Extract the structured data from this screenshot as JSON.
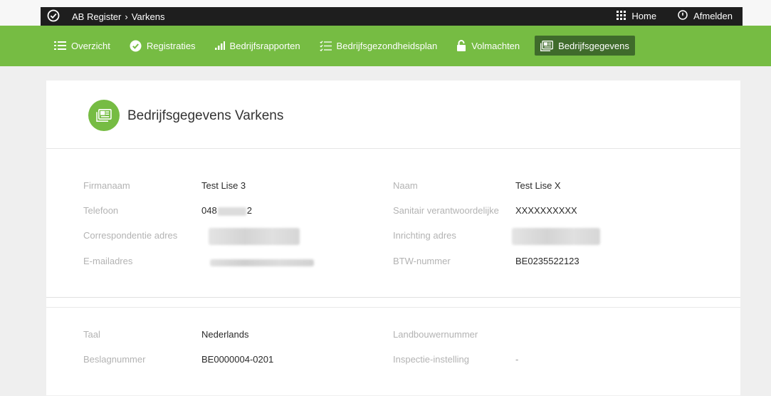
{
  "topbar": {
    "app": "AB Register",
    "separator": "›",
    "section": "Varkens",
    "home": "Home",
    "logout": "Afmelden"
  },
  "nav": [
    {
      "label": "Overzicht",
      "icon": "list-icon"
    },
    {
      "label": "Registraties",
      "icon": "check-circle-icon"
    },
    {
      "label": "Bedrijfsrapporten",
      "icon": "bar-chart-icon"
    },
    {
      "label": "Bedrijfsgezondheidsplan",
      "icon": "checklist-icon"
    },
    {
      "label": "Volmachten",
      "icon": "lock-icon"
    },
    {
      "label": "Bedrijfsgegevens",
      "icon": "id-card-icon",
      "active": true
    }
  ],
  "page": {
    "title": "Bedrijfsgegevens Varkens"
  },
  "details": {
    "firmanaam_label": "Firmanaam",
    "firmanaam_value": "Test Lise 3",
    "naam_label": "Naam",
    "naam_value": "Test Lise X",
    "telefoon_label": "Telefoon",
    "telefoon_prefix": "048",
    "telefoon_suffix": "2",
    "sanitair_label": "Sanitair verantwoordelijke",
    "sanitair_value": "XXXXXXXXXX",
    "correspondentie_label": "Correspondentie adres",
    "inrichting_label": "Inrichting adres",
    "email_label": "E-mailadres",
    "btw_label": "BTW-nummer",
    "btw_value": "BE0235522123"
  },
  "extra": {
    "taal_label": "Taal",
    "taal_value": "Nederlands",
    "landbouwer_label": "Landbouwernummer",
    "landbouwer_value": "",
    "beslag_label": "Beslagnummer",
    "beslag_value": "BE0000004-0201",
    "inspectie_label": "Inspectie-instelling",
    "inspectie_value": "-"
  },
  "colors": {
    "brand_green": "#76bc43",
    "active_nav": "#3f6b2b",
    "topbar": "#1e1e1e"
  }
}
